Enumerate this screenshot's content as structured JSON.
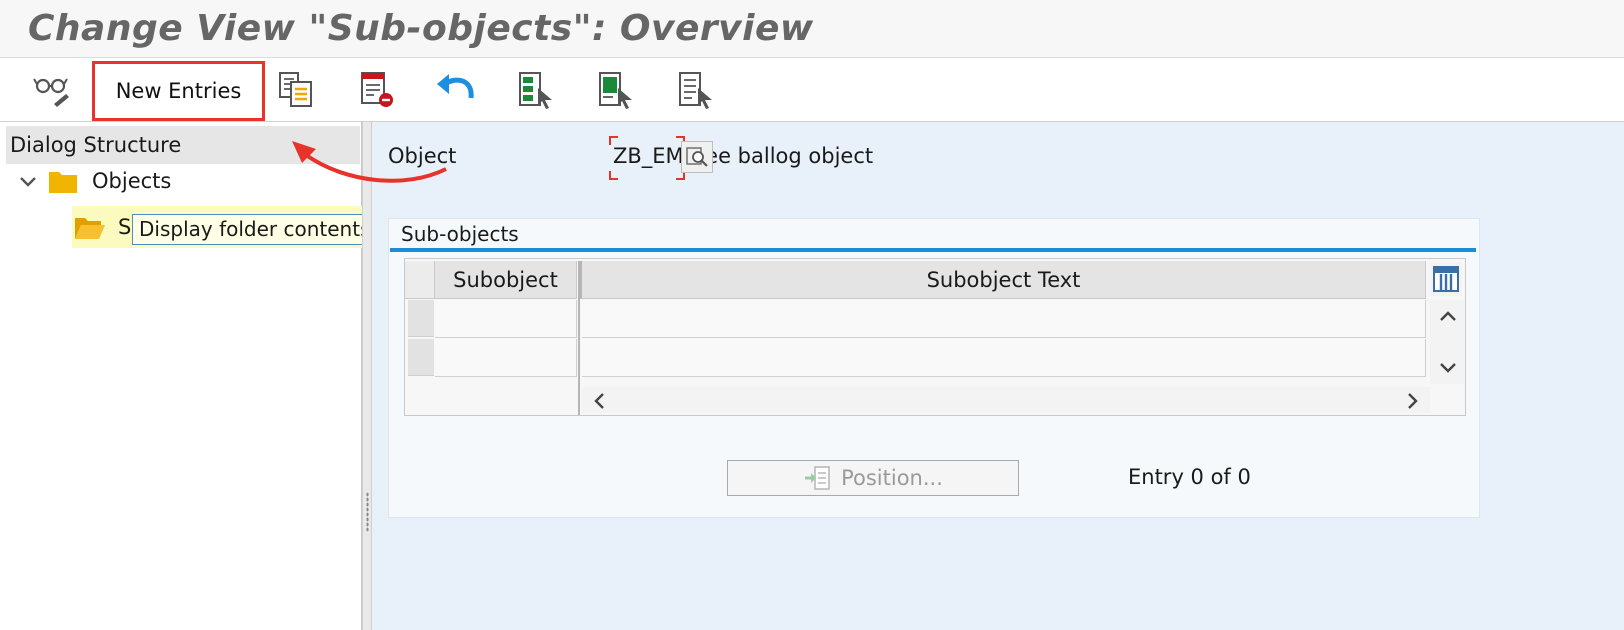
{
  "window": {
    "title": "Change View \"Sub-objects\": Overview"
  },
  "toolbar": {
    "display_change_icon": "glasses-pencil-icon",
    "new_entries_label": "New Entries",
    "copy_icon": "copy-as-icon",
    "delete_icon": "delete-icon",
    "undo_icon": "undo-icon",
    "select_all_icon": "select-all-icon",
    "select_block_icon": "select-block-icon",
    "deselect_all_icon": "deselect-all-icon"
  },
  "dialog_structure": {
    "heading": "Dialog Structure",
    "items": [
      {
        "label": "Objects",
        "expanded": true
      },
      {
        "label": "Sub-objects",
        "visible_label": "S",
        "selected": true
      }
    ],
    "tooltip": "Display folder contents"
  },
  "header_fields": {
    "object_label": "Object",
    "object_value": "ZB_EM",
    "object_text": "Employee ballog object"
  },
  "subobjects_table": {
    "title": "Sub-objects",
    "columns": [
      "Subobject",
      "Subobject Text"
    ],
    "rows": [
      {
        "subobject": "",
        "subobject_text": ""
      },
      {
        "subobject": "",
        "subobject_text": ""
      }
    ]
  },
  "footer": {
    "position_label": "Position...",
    "entry_count": "Entry 0 of 0"
  },
  "colors": {
    "highlight_red": "#e8332a",
    "accent_blue": "#1f8bd6",
    "folder_yellow": "#f1b400",
    "tree_selection": "#fbfbbf",
    "content_background": "#e8f0f9"
  }
}
